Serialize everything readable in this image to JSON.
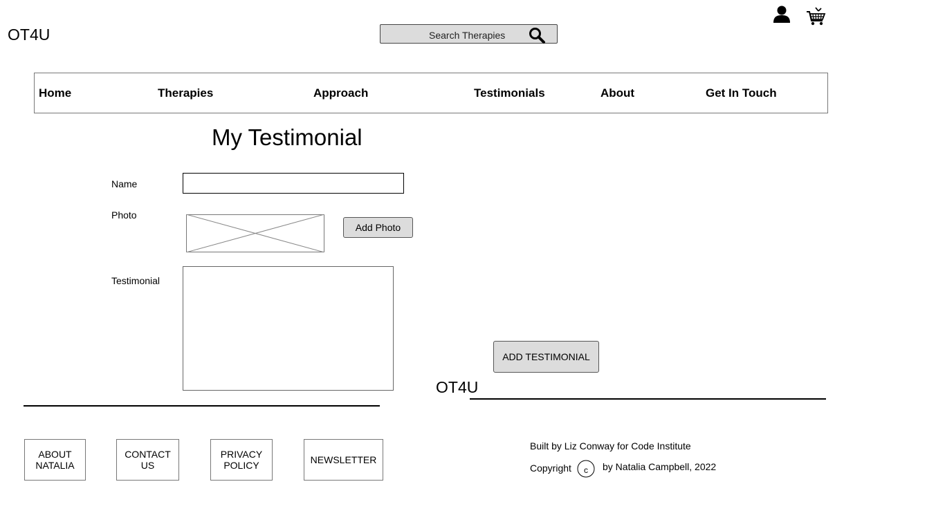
{
  "brand": {
    "name": "OT4U"
  },
  "search": {
    "placeholder": "Search Therapies",
    "icon": "search-icon"
  },
  "header_icons": {
    "account": "user-icon",
    "cart": "cart-icon"
  },
  "nav": {
    "items": [
      {
        "label": "Home"
      },
      {
        "label": "Therapies"
      },
      {
        "label": "Approach"
      },
      {
        "label": "Testimonials"
      },
      {
        "label": "About"
      },
      {
        "label": "Get In Touch"
      }
    ]
  },
  "form": {
    "title": "My Testimonial",
    "name_label": "Name",
    "name_value": "",
    "photo_label": "Photo",
    "add_photo_label": "Add Photo",
    "testimonial_label": "Testimonial",
    "testimonial_value": "",
    "submit_label": "ADD TESTIMONIAL"
  },
  "footer": {
    "brand": "OT4U",
    "links": [
      {
        "line1": "ABOUT",
        "line2": "NATALIA"
      },
      {
        "line1": "CONTACT",
        "line2": "US"
      },
      {
        "line1": "PRIVACY",
        "line2": "POLICY"
      },
      {
        "line1": "NEWSLETTER",
        "line2": ""
      }
    ],
    "credit": "Built by Liz Conway for Code Institute",
    "copyright_label": "Copyright",
    "copyright_symbol": "c",
    "copyright_by": "by Natalia Campbell, 2022"
  }
}
